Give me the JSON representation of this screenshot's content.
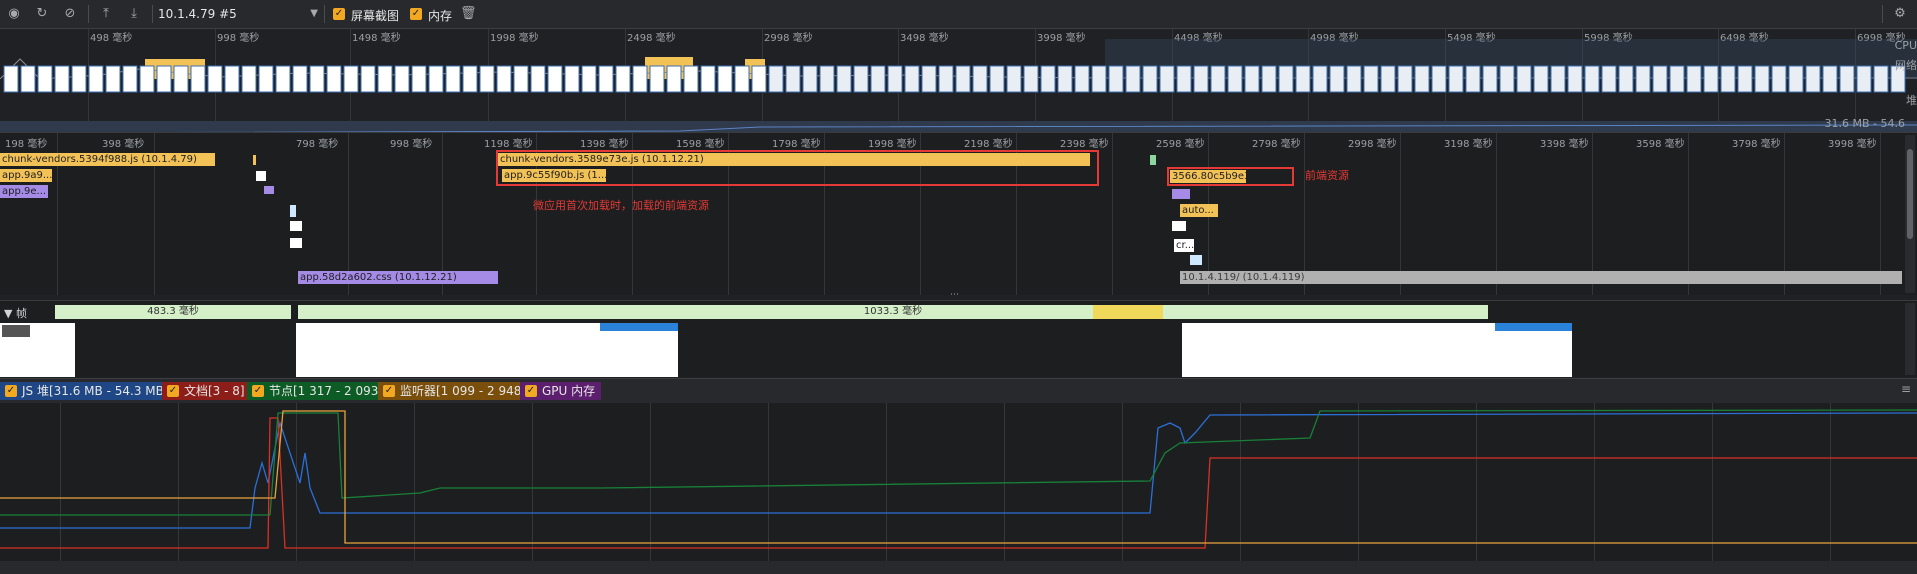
{
  "toolbar": {
    "record_label": "录制",
    "reload_label": "重新加载",
    "clear_label": "清除",
    "upload_label": "加载",
    "download_label": "保存",
    "target_select": "10.1.4.79 #5",
    "screenshots_label": "屏幕截图",
    "memory_label": "内存",
    "icons": [
      "record-icon",
      "reload-icon",
      "clear-icon",
      "upload-icon",
      "download-icon",
      "trash-icon",
      "gear-icon"
    ]
  },
  "overview": {
    "ticks": [
      "498 毫秒",
      "998 毫秒",
      "1498 毫秒",
      "1998 毫秒",
      "2498 毫秒",
      "2998 毫秒",
      "3498 毫秒",
      "3998 毫秒",
      "4498 毫秒",
      "4998 毫秒",
      "5498 毫秒",
      "5998 毫秒",
      "6498 毫秒",
      "6998 毫秒"
    ],
    "cpu_label": "CPU",
    "net_label": "网络",
    "heap_label": "堆",
    "heap_range": "31.6 MB - 54.6"
  },
  "network": {
    "ticks": [
      "198 毫秒",
      "398 毫秒",
      "798 毫秒",
      "998 毫秒",
      "1198 毫秒",
      "1398 毫秒",
      "1598 毫秒",
      "1798 毫秒",
      "1998 毫秒",
      "2198 毫秒",
      "2398 毫秒",
      "2598 毫秒",
      "2798 毫秒",
      "2998 毫秒",
      "3198 毫秒",
      "3398 毫秒",
      "3598 毫秒",
      "3798 毫秒",
      "3998 毫秒"
    ],
    "requests": {
      "chunk_vendors_a": "chunk-vendors.5394f988.js (10.1.4.79)",
      "app_a1": "app.9a9...",
      "app_a2": "app.9e...",
      "chunk_vendors_b": "chunk-vendors.3589e73e.js (10.1.12.21)",
      "app_b": "app.9c55f90b.js (1...",
      "app_css": "app.58d2a602.css (10.1.12.21)",
      "js_3566": "3566.80c5b9e3.js (...",
      "auto": "auto...",
      "cr": "cr...",
      "root_119": "10.1.4.119/ (10.1.4.119)"
    },
    "note_micro_app": "微应用首次加载时，加载的前端资源",
    "note_frontend": "前端资源"
  },
  "frames": {
    "label": "帧",
    "seg1": "483.3 毫秒",
    "seg2": "1033.3 毫秒"
  },
  "legend": {
    "js_heap": "JS 堆[31.6 MB - 54.3 MB]",
    "documents": "文档[3 - 8]",
    "nodes": "节点[1 317 - 2 093]",
    "listeners": "监听器[1 099 - 2 948]",
    "gpu": "GPU 内存",
    "colors": {
      "js_heap": "#2b6fd6",
      "documents": "#d93025",
      "nodes": "#188038",
      "listeners": "#e8a33d",
      "gpu": "#8e3ba6"
    }
  }
}
